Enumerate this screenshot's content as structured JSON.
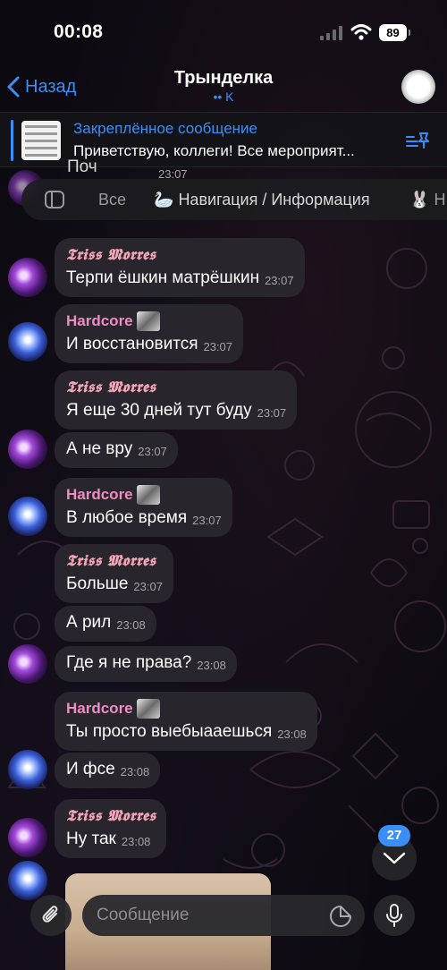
{
  "status_bar": {
    "time": "00:08",
    "battery": "89"
  },
  "header": {
    "back_label": "Назад",
    "title": "Трынделка",
    "subtitle": "•• K"
  },
  "pinned": {
    "title": "Закреплённое сообщение",
    "text": "Приветствую, коллеги! Все мероприят..."
  },
  "partial_message": {
    "text": "Поч",
    "time": "23:07"
  },
  "tabs": [
    {
      "label": "Все",
      "emoji": ""
    },
    {
      "label": "Навигация / Информация",
      "emoji": "🦢"
    },
    {
      "label": "Н",
      "emoji": "🐰"
    }
  ],
  "messages": [
    {
      "sender": "𝕿𝖗𝖎𝖘𝖘 𝕸𝖔𝖗𝖗𝖊𝖘",
      "text": "Терпи ёшкин матрёшкин",
      "time": "23:07"
    },
    {
      "sender": "Hardcore",
      "text": "И восстановится",
      "time": "23:07"
    },
    {
      "sender": "𝕿𝖗𝖎𝖘𝖘 𝕸𝖔𝖗𝖗𝖊𝖘",
      "text": "Я еще 30 дней тут буду",
      "time": "23:07"
    },
    {
      "sender": "",
      "text": "А не вру",
      "time": "23:07"
    },
    {
      "sender": "Hardcore",
      "text": "В любое время",
      "time": "23:07"
    },
    {
      "sender": "𝕿𝖗𝖎𝖘𝖘 𝕸𝖔𝖗𝖗𝖊𝖘",
      "text": "Больше",
      "time": "23:07"
    },
    {
      "sender": "",
      "text": "А рил",
      "time": "23:08"
    },
    {
      "sender": "",
      "text": "Где я не права?",
      "time": "23:08"
    },
    {
      "sender": "Hardcore",
      "text": "Ты просто выебыааешься",
      "time": "23:08"
    },
    {
      "sender": "",
      "text": "И фсе",
      "time": "23:08"
    },
    {
      "sender": "𝕿𝖗𝖎𝖘𝖘 𝕸𝖔𝖗𝖗𝖊𝖘",
      "text": "Ну так",
      "time": "23:08"
    }
  ],
  "scroll": {
    "unread_count": "27"
  },
  "input": {
    "placeholder": "Сообщение"
  },
  "colors": {
    "accent": "#3b8ef5",
    "bubble": "#2a262e",
    "triss_name": "#f3a5b5",
    "hardcore_name": "#f08cc0"
  }
}
